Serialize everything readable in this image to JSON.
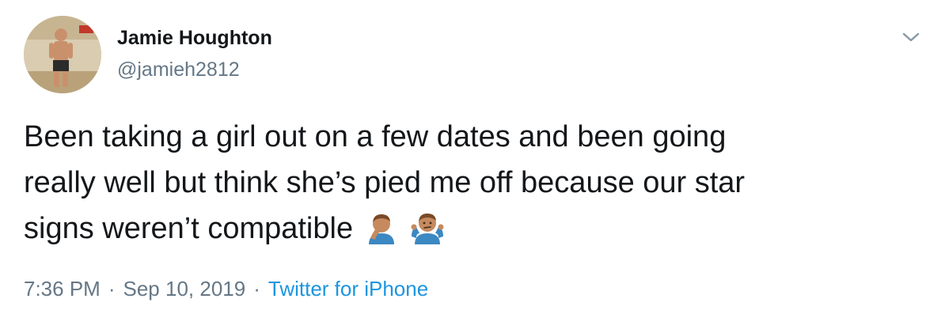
{
  "author": {
    "display_name": "Jamie Houghton",
    "handle": "@jamieh2812"
  },
  "tweet": {
    "text_lines": [
      "Been taking a girl out on a few dates and been going",
      "really well but think she’s pied me off because our star",
      "signs weren’t compatible"
    ],
    "emojis": [
      "🤦🏽‍♂️",
      "🤷🏽‍♂️"
    ]
  },
  "meta": {
    "time": "7:36 PM",
    "separator": "·",
    "date": "Sep 10, 2019",
    "source": "Twitter for iPhone"
  },
  "icons": {
    "menu": "chevron-down-icon"
  },
  "colors": {
    "text": "#14171a",
    "secondary": "#657786",
    "link": "#1b95e0"
  }
}
